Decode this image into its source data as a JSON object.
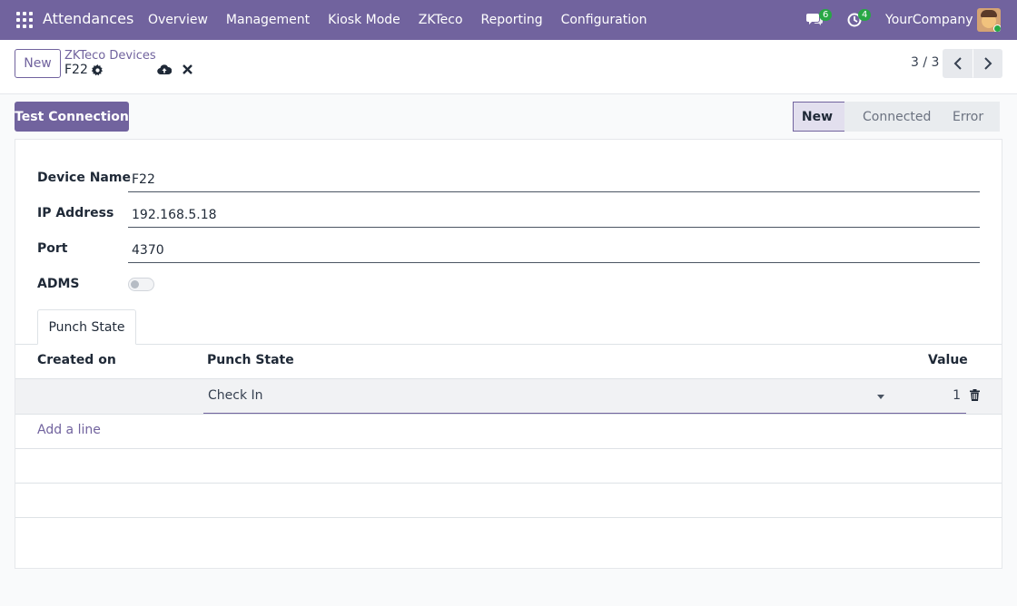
{
  "navbar": {
    "app_title": "Attendances",
    "menu": [
      "Overview",
      "Management",
      "Kiosk Mode",
      "ZKTeco",
      "Reporting",
      "Configuration"
    ],
    "chat_count": "6",
    "activity_count": "4",
    "company": "YourCompany"
  },
  "control": {
    "new_label": "New",
    "breadcrumb": "ZKTeco Devices",
    "record_name": "F22",
    "pager": "3 / 3"
  },
  "actions": {
    "test_connection": "Test Connection"
  },
  "status": {
    "stages": [
      "New",
      "Connected",
      "Error"
    ],
    "active": "New"
  },
  "form": {
    "device_name_label": "Device Name",
    "device_name": "F22",
    "ip_label": "IP Address",
    "ip": "192.168.5.18",
    "port_label": "Port",
    "port": "4370",
    "adms_label": "ADMS",
    "adms_enabled": false
  },
  "tab": {
    "label": "Punch State"
  },
  "table": {
    "headers": [
      "Created on",
      "Punch State",
      "Value"
    ],
    "rows": [
      {
        "created_on": "",
        "punch_state": "Check In",
        "value": "1"
      }
    ],
    "add_line": "Add a line"
  },
  "colors": {
    "brand": "#71639e",
    "badge": "#28a745"
  }
}
